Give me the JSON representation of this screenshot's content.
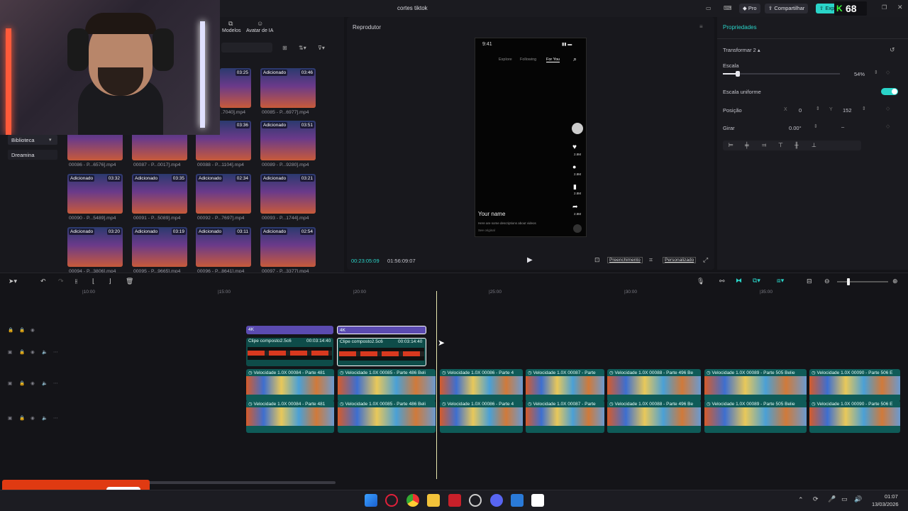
{
  "app": {
    "title": "cortes tiktok",
    "pro_label": "Pro",
    "share_label": "Compartilhar",
    "export_label": "Exportar",
    "stream_counter": "68"
  },
  "media": {
    "tabs": [
      "Modelos",
      "Avatar de IA"
    ],
    "sidebar": [
      "Biblioteca",
      "Dreamina"
    ],
    "items": [
      {
        "badge": "",
        "duration": "03:25",
        "name": ".7040].mp4"
      },
      {
        "badge": "Adicionado",
        "duration": "03:46",
        "name": "00085 - P...6977].mp4"
      },
      {
        "badge": "",
        "duration": "",
        "name": "00086 - P...6576].mp4"
      },
      {
        "badge": "",
        "duration": "",
        "name": "00087 - P...0017].mp4"
      },
      {
        "badge": "",
        "duration": "03:36",
        "name": "00088 - P...1104].mp4"
      },
      {
        "badge": "Adicionado",
        "duration": "03:51",
        "name": "00089 - P...9280].mp4"
      },
      {
        "badge": "Adicionado",
        "duration": "03:32",
        "name": "00090 - P...5489].mp4"
      },
      {
        "badge": "Adicionado",
        "duration": "03:35",
        "name": "00091 - P...5089].mp4"
      },
      {
        "badge": "Adicionado",
        "duration": "02:34",
        "name": "00092 - P...7697].mp4"
      },
      {
        "badge": "Adicionado",
        "duration": "03:21",
        "name": "00093 - P...1744].mp4"
      },
      {
        "badge": "Adicionado",
        "duration": "03:20",
        "name": "00094 - P...3806].mp4"
      },
      {
        "badge": "Adicionado",
        "duration": "03:19",
        "name": "00095 - P...9665].mp4"
      },
      {
        "badge": "Adicionado",
        "duration": "03:11",
        "name": "00096 - P...8641].mp4"
      },
      {
        "badge": "Adicionado",
        "duration": "02:54",
        "name": "00097 - P...3377].mp4"
      }
    ]
  },
  "player": {
    "title": "Reprodutor",
    "current_time": "00:23:05:09",
    "total_time": "01:56:09:07",
    "fill_label": "Preenchimento",
    "custom_label": "Personalizado",
    "phone": {
      "time": "9:41",
      "tabs": [
        "Explore",
        "Following",
        "For You"
      ],
      "username": "Your name",
      "description": "Here are some descriptions about videos",
      "see_original": "See original",
      "counts": [
        "2.8M",
        "2.8M",
        "2.8M",
        "2.8M"
      ]
    }
  },
  "props": {
    "title": "Propriedades",
    "section": "Transformar 2",
    "scale_label": "Escala",
    "scale_value": "54%",
    "scale_fraction": 0.54,
    "uniform_label": "Escala uniforme",
    "position_label": "Posição",
    "pos_x_label": "X",
    "pos_x": "0",
    "pos_y_label": "Y",
    "pos_y": "152",
    "rotate_label": "Girar",
    "rotate_value": "0.00°",
    "rotate_dash": "–"
  },
  "timeline": {
    "ruler": [
      "|10:00",
      "|15:00",
      "|20:00",
      "|25:00",
      "|30:00",
      "|35:00"
    ],
    "tag_4k": "4K",
    "compound_label": "Clipe composto2.5c6",
    "compound_duration": "00:03:14:40",
    "speed_label": "Velocidade 1.0X",
    "video_clips": [
      "00084 - Parte 481",
      "00085 - Parte 486 Beli",
      "00086 - Parte 4",
      "00087 - Parte",
      "00088 - Parte 496 Be",
      "00089 - Parte 505 Belie",
      "00090 - Parte 506 E"
    ]
  },
  "taskbar": {
    "time": "01:07",
    "date": "13/03/2026"
  },
  "colors": {
    "accent": "#2ad4c8",
    "purple": "#5b4bb0",
    "clip_teal": "#0f5b58"
  }
}
